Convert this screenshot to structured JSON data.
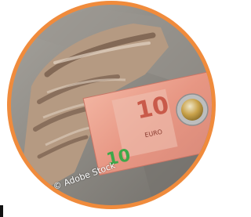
{
  "credit": "© Adobe Stock",
  "colors": {
    "ring": "#f08b3c",
    "ground": "#8f8c86",
    "glove": "#b89a80",
    "banknote": "#e8a08c",
    "coin_gold": "#c9a24a",
    "coin_silver": "#b8b8b8"
  },
  "banknote": {
    "denomination_top": "10",
    "denomination_bottom": "10",
    "currency_label": "EURO"
  },
  "icons": [
    "work-glove",
    "ten-euro-banknote",
    "two-euro-coin"
  ]
}
